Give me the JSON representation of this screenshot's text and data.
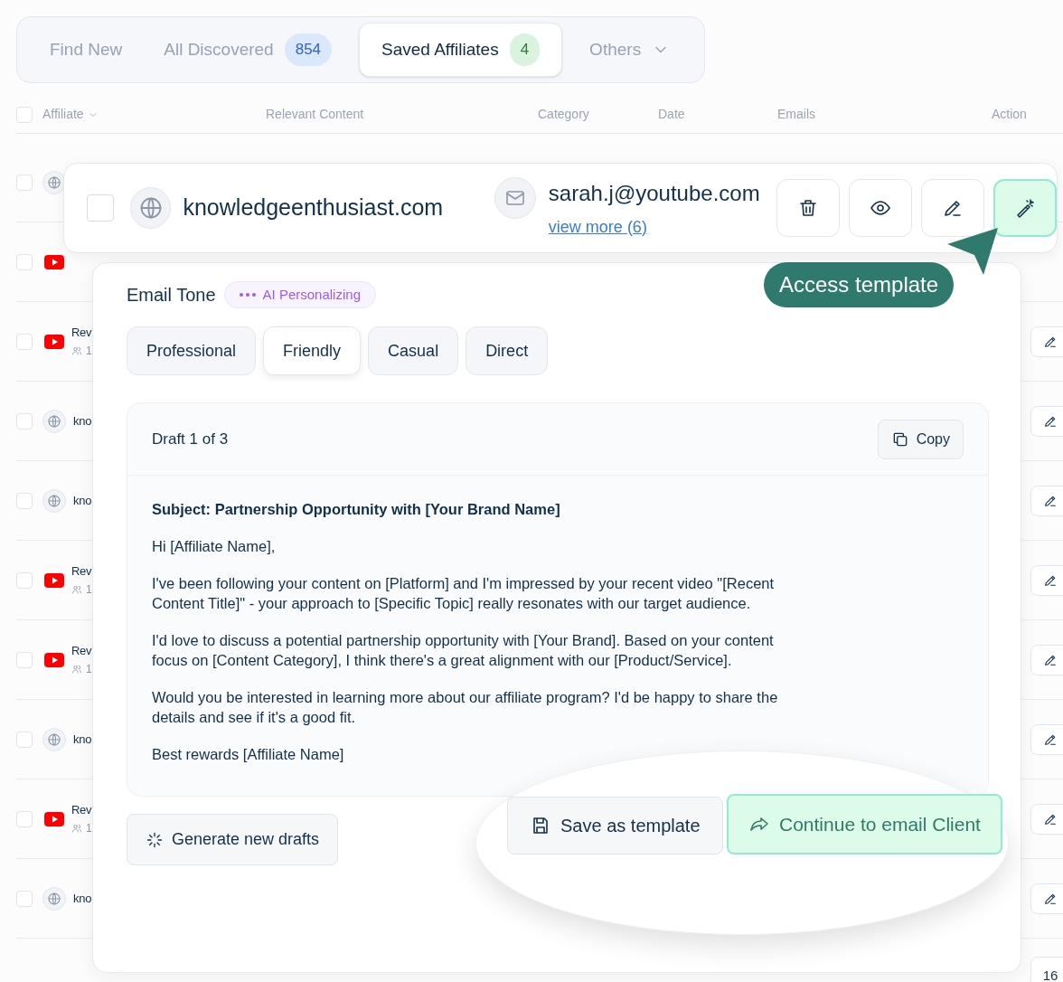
{
  "tabs": [
    {
      "label": "Find New",
      "selected": false
    },
    {
      "label": "All Discovered",
      "count": "854",
      "selected": false
    },
    {
      "label": "Saved Affiliates",
      "count": "4",
      "selected": true
    },
    {
      "label": "Others",
      "kind": "dropdown",
      "selected": false
    }
  ],
  "table": {
    "columns": [
      "Affiliate",
      "Relevant Content",
      "Category",
      "Date",
      "Emails",
      "Action"
    ],
    "all_checked": false,
    "rows": [
      {
        "kind": "website",
        "checked": false
      },
      {
        "kind": "youtube",
        "checked": false
      },
      {
        "kind": "youtube",
        "label": "Rev",
        "followers": "1",
        "checked": false
      },
      {
        "kind": "website",
        "label": "kno",
        "checked": false
      },
      {
        "kind": "website",
        "label": "kno",
        "checked": false
      },
      {
        "kind": "youtube",
        "label": "Rev",
        "followers": "1",
        "checked": false
      },
      {
        "kind": "youtube",
        "label": "Rev",
        "followers": "1",
        "checked": false
      },
      {
        "kind": "website",
        "label": "kno",
        "checked": false
      },
      {
        "kind": "youtube",
        "label": "Rev",
        "followers": "1",
        "checked": false
      },
      {
        "kind": "website",
        "label": "kno",
        "checked": false
      }
    ]
  },
  "pagination": {
    "last_page": "16"
  },
  "focused_row": {
    "checked": false,
    "domain": "knowledgeenthusiast.com",
    "email": "sarah.j@youtube.com",
    "more_link": "view more (6)",
    "actions": [
      {
        "kind": "delete",
        "highlighted": false
      },
      {
        "kind": "view",
        "highlighted": false
      },
      {
        "kind": "edit",
        "highlighted": false
      },
      {
        "kind": "template",
        "highlighted": true
      }
    ]
  },
  "callout": {
    "text": "Access template"
  },
  "email_panel": {
    "title": "Email Tone",
    "status_badge": "AI Personalizing",
    "tones": [
      {
        "label": "Professional",
        "selected": false
      },
      {
        "label": "Friendly",
        "selected": true
      },
      {
        "label": "Casual",
        "selected": false
      },
      {
        "label": "Direct",
        "selected": false
      }
    ],
    "draft": {
      "header": "Draft 1 of 3",
      "copy_button": "Copy",
      "subject": "Subject: Partnership Opportunity with [Your Brand Name]",
      "paragraphs": [
        "Hi [Affiliate Name],",
        "I've been following your content on [Platform] and I'm impressed by your recent video \"[Recent Content Title]\" - your approach to [Specific Topic] really resonates with our target audience.",
        "I'd love to discuss a potential partnership opportunity with [Your Brand]. Based on your content focus on [Content Category], I think there's a great alignment with our [Product/Service].",
        "Would you be interested in learning more about our affiliate program? I'd be happy to share the details and see if it's a good fit.",
        "Best rewards [Affiliate Name]"
      ]
    },
    "generate_button": "Generate new drafts",
    "save_button": "Save as template",
    "continue_button": "Continue to email Client"
  }
}
